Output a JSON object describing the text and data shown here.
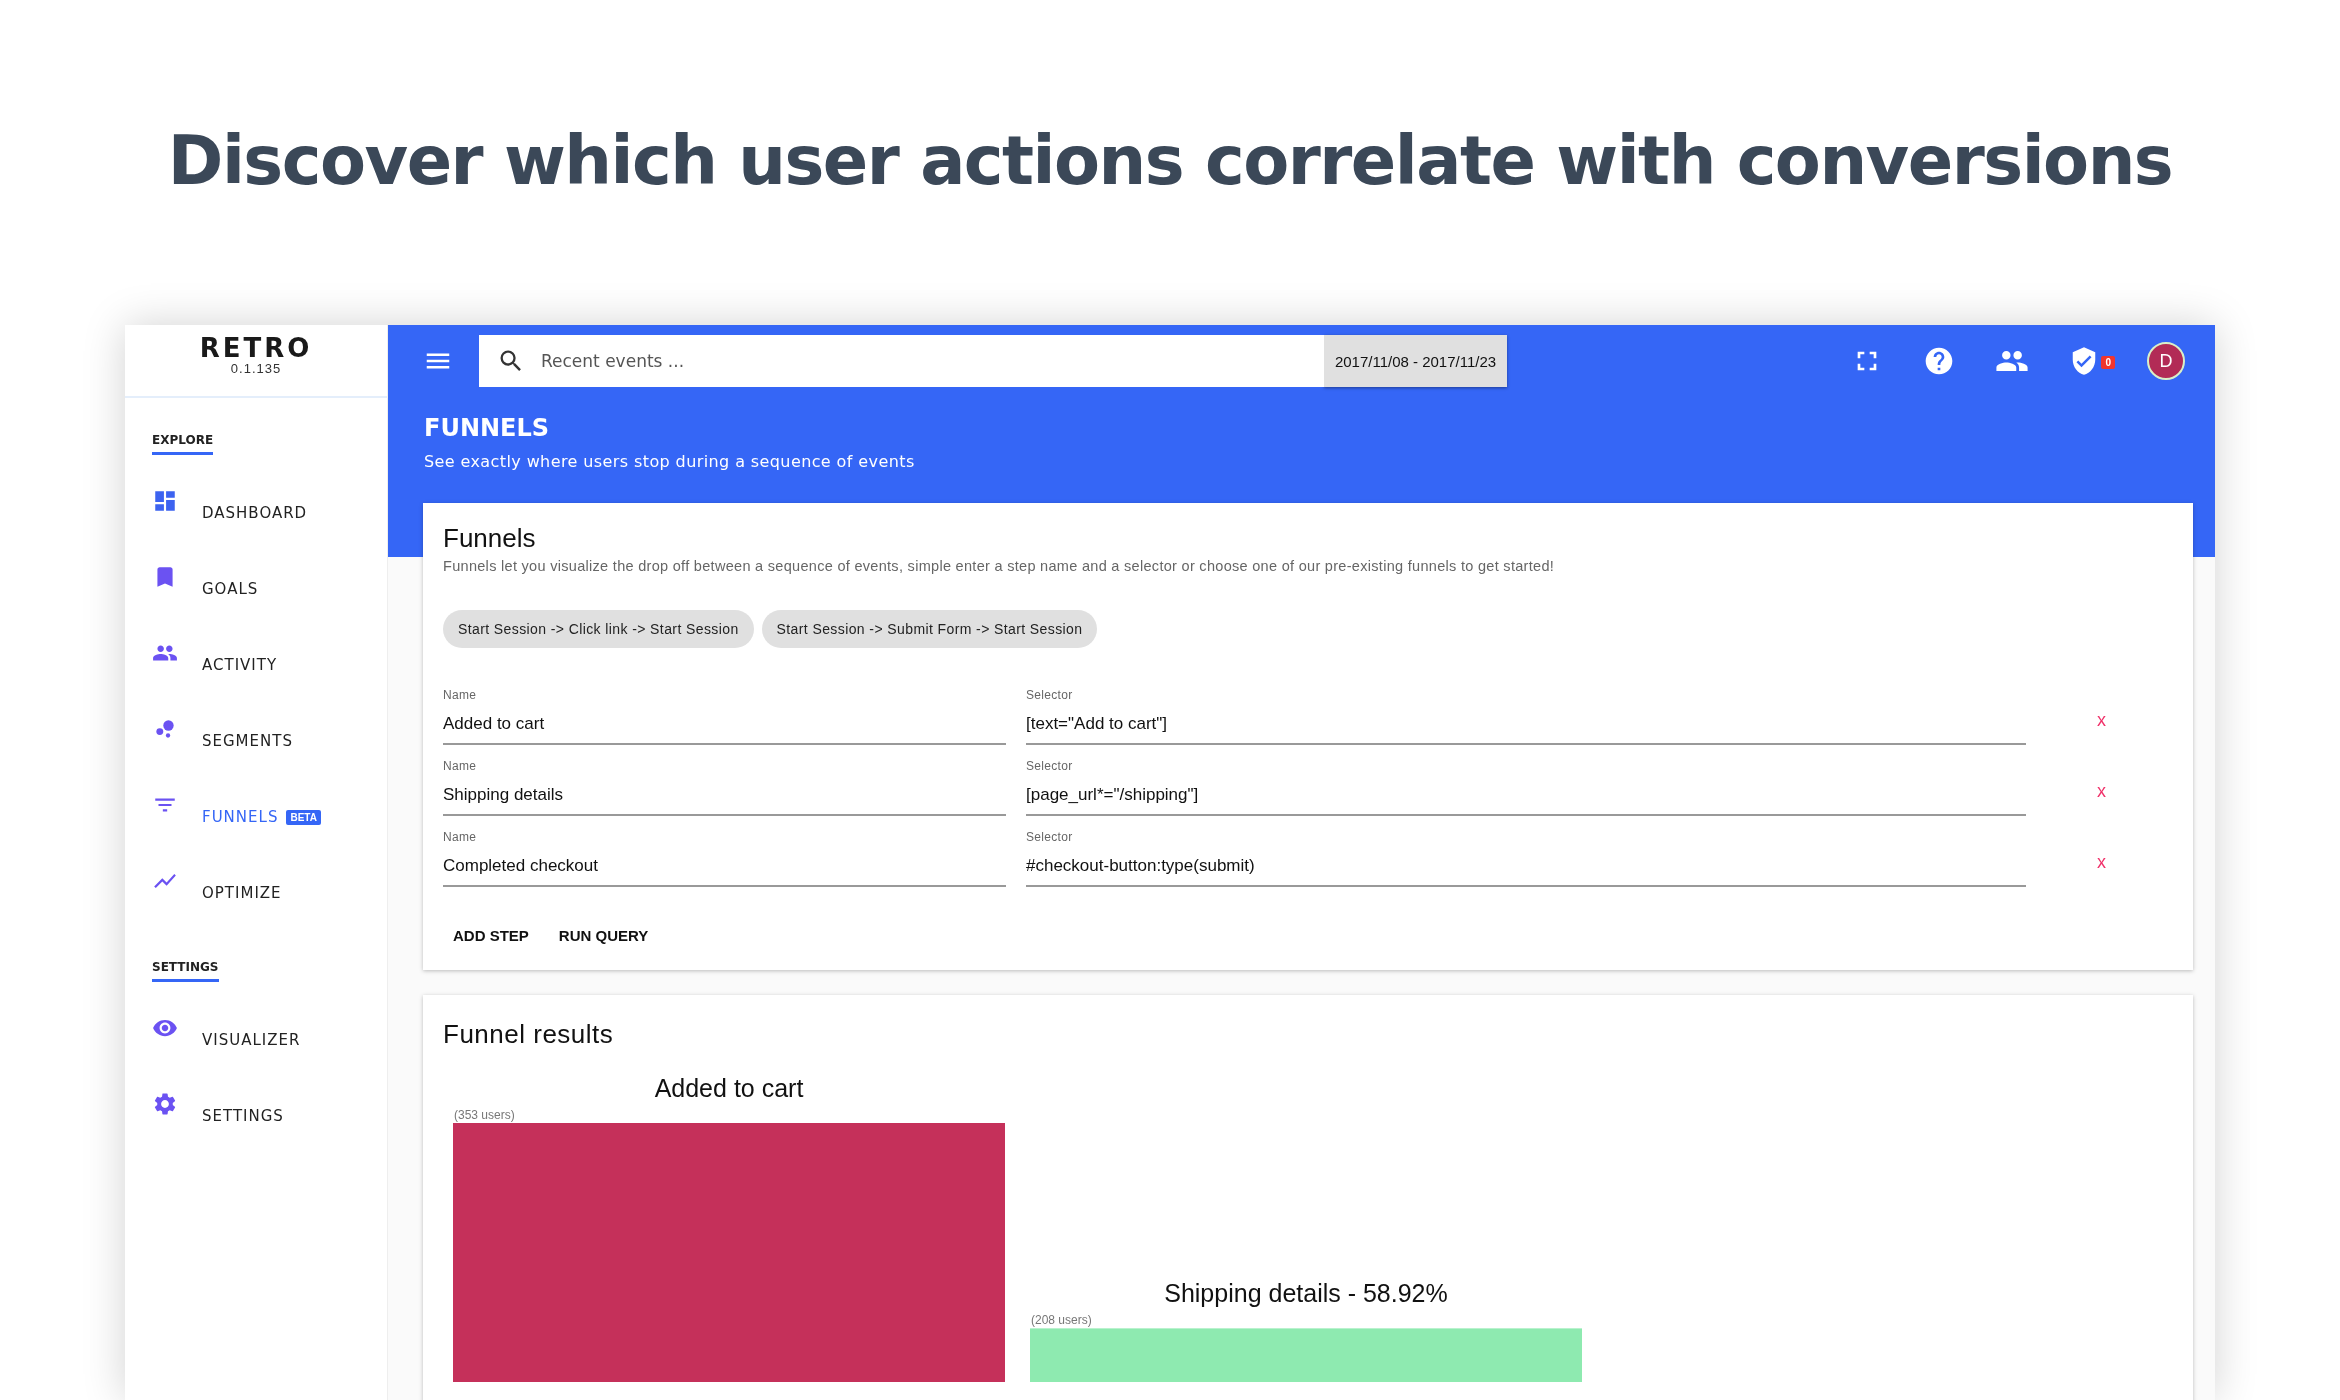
{
  "headline": "Discover which user actions correlate with conversions",
  "app": {
    "logo": "RETRO",
    "version": "0.1.135",
    "sidebar": {
      "sections": [
        {
          "title": "EXPLORE",
          "items": [
            {
              "label": "DASHBOARD",
              "selected": false
            },
            {
              "label": "GOALS",
              "selected": false
            },
            {
              "label": "ACTIVITY",
              "selected": false
            },
            {
              "label": "SEGMENTS",
              "selected": false
            },
            {
              "label": "FUNNELS",
              "selected": true,
              "badge": "BETA"
            },
            {
              "label": "OPTIMIZE",
              "selected": false
            }
          ]
        },
        {
          "title": "SETTINGS",
          "items": [
            {
              "label": "VISUALIZER",
              "selected": false
            },
            {
              "label": "SETTINGS",
              "selected": false
            }
          ]
        }
      ]
    },
    "topbar": {
      "search": {
        "placeholder": "Recent events ..."
      },
      "date_range": "2017/11/08 - 2017/11/23",
      "notification_count": "0",
      "avatar": "D"
    },
    "page": {
      "title": "FUNNELS",
      "subtitle": "See exactly where users stop during a sequence of events"
    },
    "funnel_card": {
      "title": "Funnels",
      "description": "Funnels let you visualize the drop off between a sequence of events, simple enter a step name and a selector or choose one of our pre-existing funnels to get started!",
      "presets": [
        "Start Session -> Click link -> Start Session",
        "Start Session -> Submit Form -> Start Session"
      ],
      "steps": [
        {
          "name_label": "Name",
          "name": "Added to cart",
          "selector_label": "Selector",
          "selector": "[text=\"Add to cart\"]",
          "remove": "x"
        },
        {
          "name_label": "Name",
          "name": "Shipping details",
          "selector_label": "Selector",
          "selector": "[page_url*=\"/shipping\"]",
          "remove": "x"
        },
        {
          "name_label": "Name",
          "name": "Completed checkout",
          "selector_label": "Selector",
          "selector": "#checkout-button:type(submit)",
          "remove": "x"
        }
      ],
      "buttons": [
        "ADD STEP",
        "RUN QUERY"
      ]
    },
    "results_card": {
      "title": "Funnel results",
      "chart_data": {
        "type": "bar",
        "categories": [
          "Added to cart",
          "Shipping details - 58.92%"
        ],
        "values": [
          353,
          208
        ],
        "colors": [
          "#c5305a",
          "#8eeab0"
        ],
        "value_labels": [
          "(353 users)",
          "(208 users)"
        ]
      }
    }
  }
}
